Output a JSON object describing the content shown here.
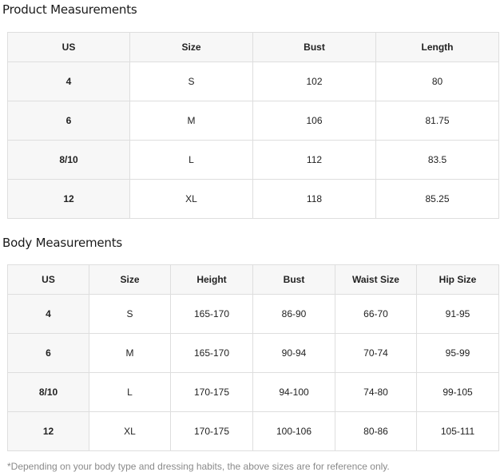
{
  "product": {
    "title": "Product Measurements",
    "headers": [
      "US",
      "Size",
      "Bust",
      "Length"
    ],
    "rows": [
      [
        "4",
        "S",
        "102",
        "80"
      ],
      [
        "6",
        "M",
        "106",
        "81.75"
      ],
      [
        "8/10",
        "L",
        "112",
        "83.5"
      ],
      [
        "12",
        "XL",
        "118",
        "85.25"
      ]
    ]
  },
  "body": {
    "title": "Body Measurements",
    "headers": [
      "US",
      "Size",
      "Height",
      "Bust",
      "Waist Size",
      "Hip Size"
    ],
    "rows": [
      [
        "4",
        "S",
        "165-170",
        "86-90",
        "66-70",
        "91-95"
      ],
      [
        "6",
        "M",
        "165-170",
        "90-94",
        "70-74",
        "95-99"
      ],
      [
        "8/10",
        "L",
        "170-175",
        "94-100",
        "74-80",
        "99-105"
      ],
      [
        "12",
        "XL",
        "170-175",
        "100-106",
        "80-86",
        "105-111"
      ]
    ]
  },
  "footnote": "*Depending on your body type and dressing habits, the above sizes are for reference only."
}
